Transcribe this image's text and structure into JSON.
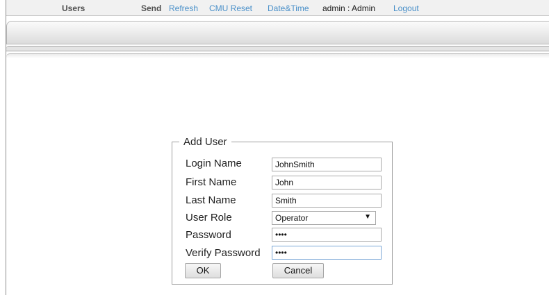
{
  "header": {
    "nav": {
      "users": "Users",
      "send": "Send",
      "refresh": "Refresh",
      "cmu_reset": "CMU Reset",
      "date_time": "Date&Time",
      "user_info": "admin : Admin",
      "logout": "Logout"
    }
  },
  "add_user": {
    "legend": "Add User",
    "fields": {
      "login_name": {
        "label": "Login Name",
        "value": "JohnSmith"
      },
      "first_name": {
        "label": "First Name",
        "value": "John"
      },
      "last_name": {
        "label": "Last Name",
        "value": "Smith"
      },
      "user_role": {
        "label": "User Role",
        "value": "Operator"
      },
      "password": {
        "label": "Password",
        "value": "••••"
      },
      "verify_password": {
        "label": "Verify Password",
        "value": "••••"
      }
    },
    "ok_label": "OK",
    "cancel_label": "Cancel"
  },
  "colors": {
    "link": "#4a90c9",
    "bar": "#f1f1f1"
  }
}
